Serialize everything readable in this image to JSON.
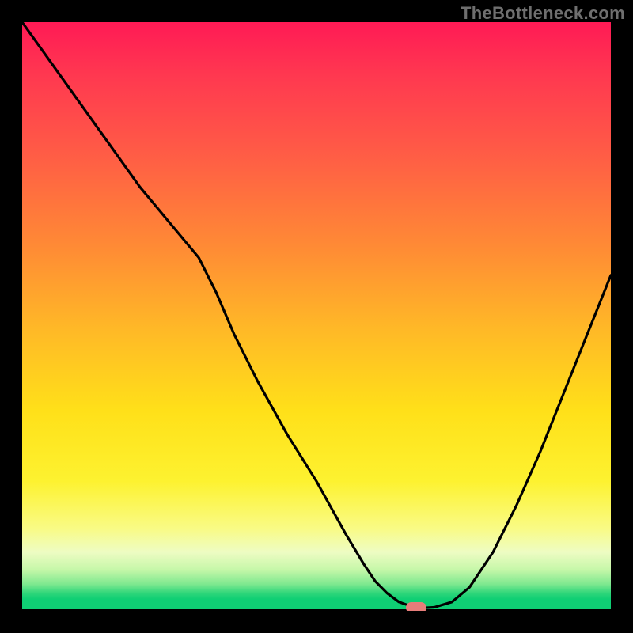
{
  "watermark": "TheBottleneck.com",
  "colors": {
    "frame_bg": "#000000",
    "watermark_text": "#6f6f6f",
    "curve": "#000000",
    "marker": "#e77d7a",
    "gradient_top": "#ff1a55",
    "gradient_bottom": "#0fcf74"
  },
  "chart_data": {
    "type": "line",
    "title": "",
    "xlabel": "",
    "ylabel": "",
    "xlim": [
      0,
      100
    ],
    "ylim": [
      0,
      100
    ],
    "x": [
      0,
      5,
      10,
      15,
      20,
      25,
      30,
      33,
      36,
      40,
      45,
      50,
      55,
      58,
      60,
      62,
      64,
      66,
      68,
      70,
      73,
      76,
      80,
      84,
      88,
      92,
      96,
      100
    ],
    "y": [
      100,
      93,
      86,
      79,
      72,
      66,
      60,
      54,
      47,
      39,
      30,
      22,
      13,
      8,
      5,
      3,
      1.5,
      0.8,
      0.5,
      0.6,
      1.5,
      4,
      10,
      18,
      27,
      37,
      47,
      57
    ],
    "marker": {
      "x": 67,
      "y": 0.5
    },
    "annotations": []
  }
}
